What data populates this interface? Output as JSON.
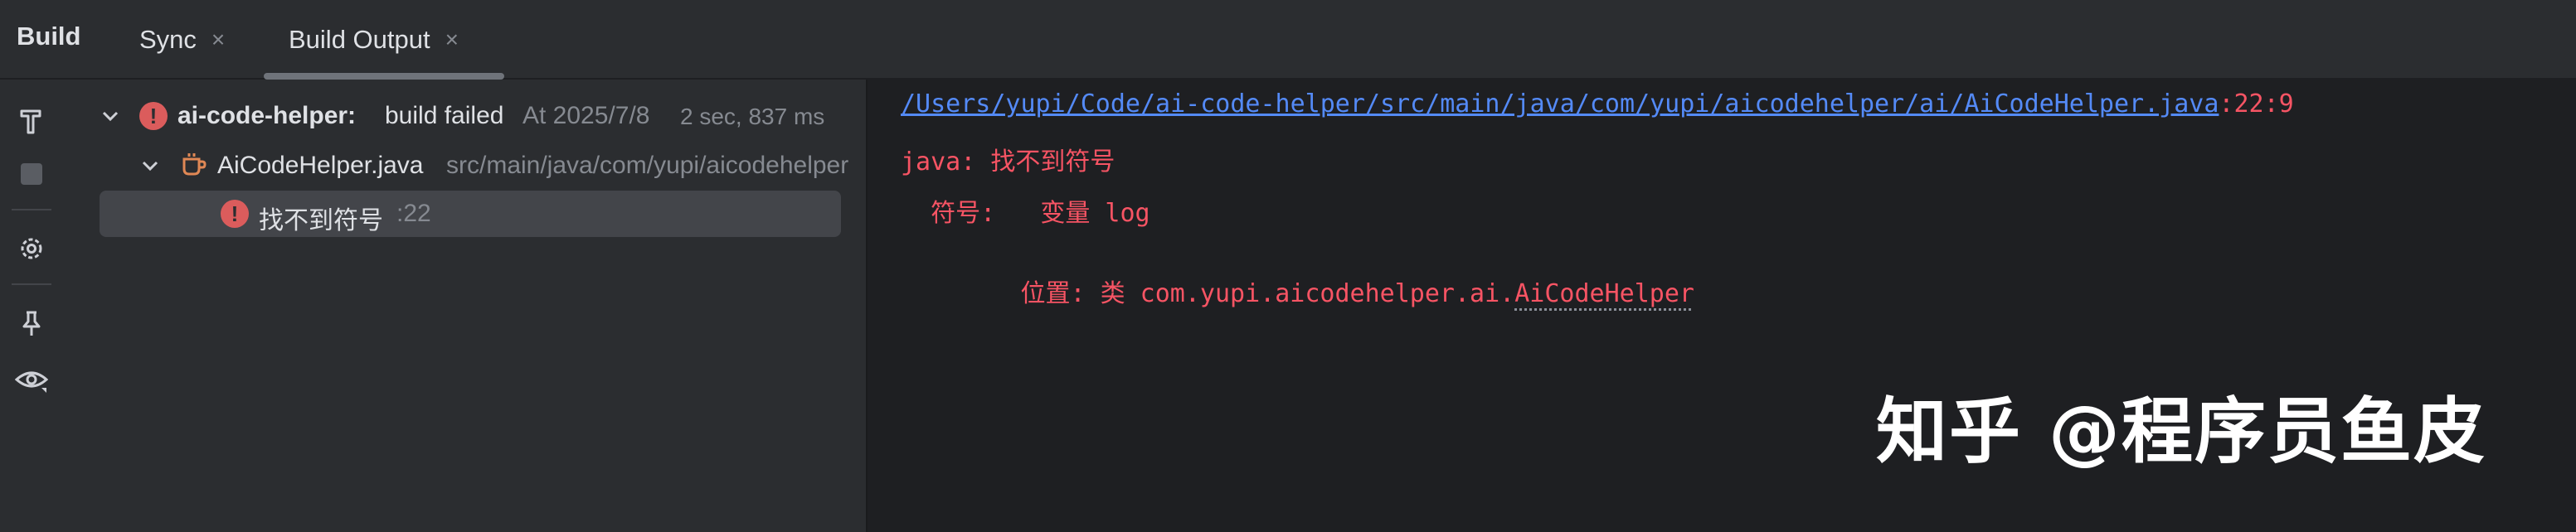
{
  "header": {
    "tool_title": "Build",
    "tabs": [
      {
        "label": "Sync",
        "close": "×"
      },
      {
        "label": "Build Output",
        "close": "×"
      }
    ]
  },
  "toolstrip": {
    "icons": [
      "hammer-icon",
      "stop-icon",
      "settings-icon",
      "pin-icon",
      "eye-icon"
    ]
  },
  "tree": {
    "root": {
      "project": "ai-code-helper:",
      "status": "build failed",
      "timestamp": "At 2025/7/8",
      "duration": "2 sec, 837 ms"
    },
    "file": {
      "name": "AiCodeHelper.java",
      "path": "src/main/java/com/yupi/aicodehelper"
    },
    "error": {
      "message": "找不到符号",
      "line": ":22"
    }
  },
  "console": {
    "link_path": "/Users/yupi/Code/ai-code-helper/src/main/java/com/yupi/aicodehelper/ai/AiCodeHelper.java",
    "link_pos": ":22:9",
    "line1": "java: 找不到符号",
    "line2": "  符号:   变量 log",
    "line3_prefix": "  位置: 类 com.yupi.aicodehelper.ai.",
    "line3_class": "AiCodeHelper"
  },
  "watermark": "知乎 @程序员鱼皮",
  "colors": {
    "error": "#f75464",
    "link": "#548af7",
    "panel": "#2b2d30",
    "console_bg": "#1e1f22"
  }
}
